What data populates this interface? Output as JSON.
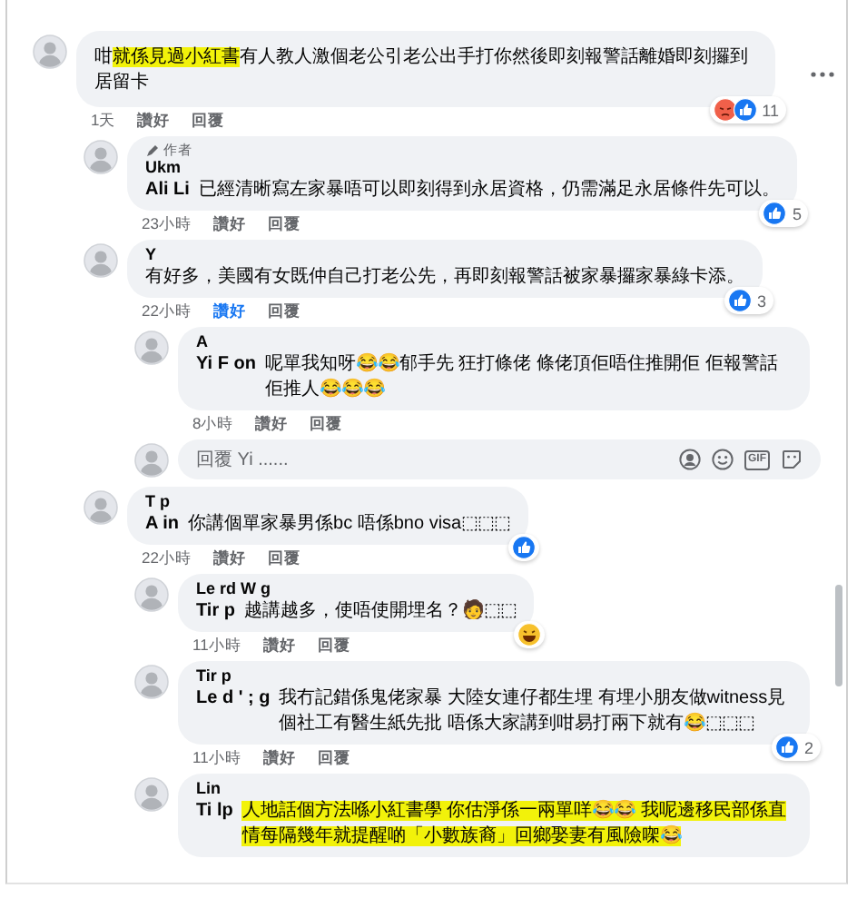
{
  "comments": [
    {
      "body": {
        "parts": [
          {
            "text": "咁",
            "highlighted": false
          },
          {
            "text": "就係見過小紅書",
            "highlighted": true
          },
          {
            "text": "有人教人激個老公引老公出手打你然後即刻報警話離婚即刻攞到居留卡",
            "highlighted": false
          }
        ]
      },
      "reactions": {
        "icons": [
          {
            "kind": "angry"
          },
          {
            "kind": "like"
          }
        ],
        "count": "11"
      },
      "time": "1天",
      "like": "讚好",
      "reply": "回覆",
      "liked": false,
      "more": true,
      "replies": [
        {
          "author_badge": "作者",
          "name": "Ukm",
          "body": {
            "mention": "Ali Li",
            "parts": [
              {
                "text": "已經清晰寫左家暴唔可以即刻得到永居資格，仍需滿足永居條件先可以。",
                "highlighted": false
              }
            ]
          },
          "reactions": {
            "icons": [
              {
                "kind": "like"
              }
            ],
            "count": "5"
          },
          "time": "23小時",
          "like": "讚好",
          "reply": "回覆",
          "liked": false
        },
        {
          "name": "Y",
          "body": {
            "parts": [
              {
                "text": "有好多，美國有女既仲自己打老公先，再即刻報警話被家暴攞家暴綠卡添。",
                "highlighted": false
              }
            ]
          },
          "reactions": {
            "icons": [
              {
                "kind": "like"
              }
            ],
            "count": "3"
          },
          "time": "22小時",
          "like": "讚好",
          "reply": "回覆",
          "liked": true,
          "replies": [
            {
              "name": "A",
              "body": {
                "mention": "Yi F  on",
                "parts": [
                  {
                    "text": "呢單我知呀😂😂郁手先 狂打條佬 條佬頂佢唔住推開佢 佢報警話佢推人😂😂😂",
                    "highlighted": false
                  }
                ]
              },
              "time": "8小時",
              "like": "讚好",
              "reply": "回覆",
              "liked": false
            }
          ],
          "reply_box": {
            "placeholder": "回覆 Yi ......",
            "icons": [
              {
                "kind": "avatar"
              },
              {
                "kind": "smiley"
              },
              {
                "kind": "gif",
                "text": "GIF"
              },
              {
                "kind": "sticker"
              }
            ]
          }
        },
        {
          "name": "T  p",
          "body": {
            "mention": "A  in",
            "parts": [
              {
                "text": "你講個單家暴男係bc 唔係bno visa⬚⬚⬚",
                "highlighted": false
              }
            ]
          },
          "reactions": {
            "icons": [
              {
                "kind": "like"
              }
            ]
          },
          "time": "22小時",
          "like": "讚好",
          "reply": "回覆",
          "liked": false,
          "replies": [
            {
              "name": "Le  rd W  g",
              "body": {
                "mention": "Tir  p",
                "parts": [
                  {
                    "text": "越講越多，使唔使開埋名？🧑⬚⬚",
                    "highlighted": false
                  }
                ]
              },
              "reactions": {
                "icons": [
                  {
                    "kind": "haha"
                  }
                ]
              },
              "time": "11小時",
              "like": "讚好",
              "reply": "回覆",
              "liked": false
            },
            {
              "name": "Tir  p",
              "body": {
                "mention": "Le  d ' ;  g",
                "parts": [
                  {
                    "text": "我冇記錯係鬼佬家暴 大陸女連仔都生埋 有埋小朋友做witness見個社工有醫生紙先批 唔係大家講到咁易打兩下就有😂⬚⬚⬚",
                    "highlighted": false
                  }
                ]
              },
              "reactions": {
                "icons": [
                  {
                    "kind": "like"
                  }
                ],
                "count": "2"
              },
              "time": "11小時",
              "like": "讚好",
              "reply": "回覆",
              "liked": false
            },
            {
              "name": "Lin",
              "body": {
                "mention": "Ti  lp",
                "parts": [
                  {
                    "text": "人地話個方法喺小紅書學 你估淨係一兩單咩😂😂 我呢邊移民部係直情每隔幾年就提醒啲「小數族裔」回鄉娶妻有風險㗎😂",
                    "highlighted": true
                  }
                ]
              }
            }
          ]
        }
      ]
    }
  ]
}
